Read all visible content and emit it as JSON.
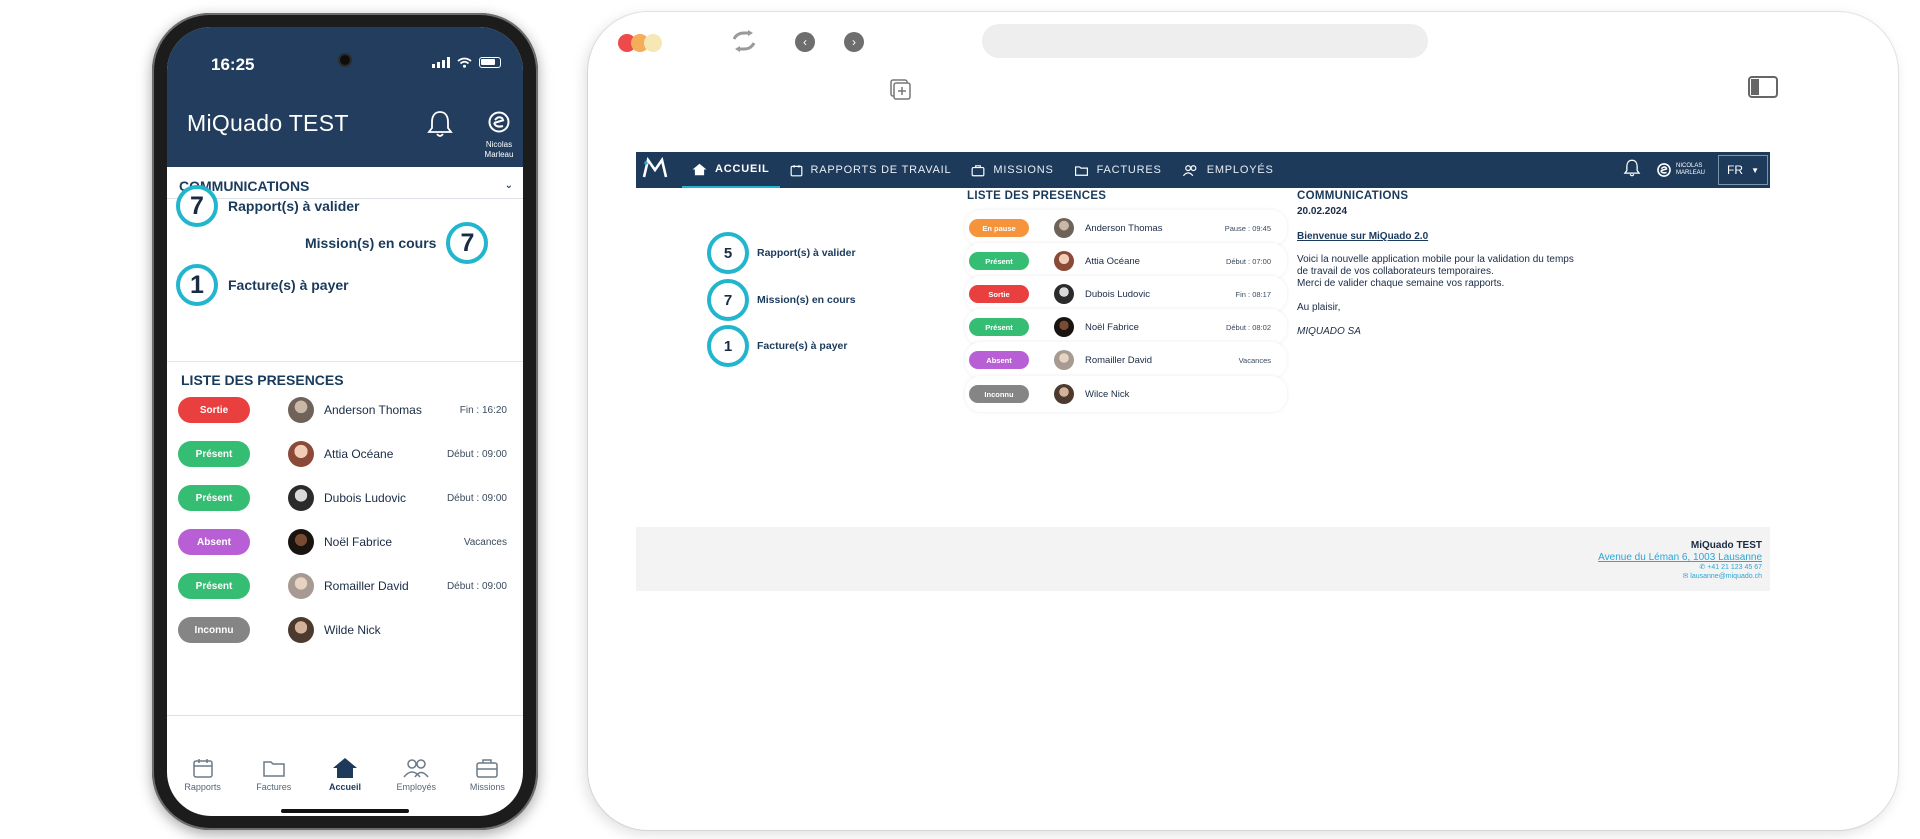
{
  "colors": {
    "navy": "#223d5d",
    "accent": "#22b5ce",
    "status_pause": "#f5943a",
    "status_present": "#35bd73",
    "status_out": "#ea3f3f",
    "status_absent": "#b85fd6",
    "status_unknown": "#858585"
  },
  "phone": {
    "time": "16:25",
    "app_title": "MiQuado TEST",
    "user_name": "Nicolas Marleau",
    "communications_title": "COMMUNICATIONS",
    "counters": [
      {
        "value": "7",
        "label": "Rapport(s) à valider"
      },
      {
        "value": "7",
        "label": "Mission(s) en cours"
      },
      {
        "value": "1",
        "label": "Facture(s) à payer"
      }
    ],
    "presences_title": "LISTE DES PRESENCES",
    "presences": [
      {
        "status": "Sortie",
        "name": "Anderson Thomas",
        "info": "Fin : 16:20"
      },
      {
        "status": "Présent",
        "name": "Attia Océane",
        "info": "Début : 09:00"
      },
      {
        "status": "Présent",
        "name": "Dubois Ludovic",
        "info": "Début : 09:00"
      },
      {
        "status": "Absent",
        "name": "Noël Fabrice",
        "info": "Vacances"
      },
      {
        "status": "Présent",
        "name": "Romailler David",
        "info": "Début : 09:00"
      },
      {
        "status": "Inconnu",
        "name": "Wilde Nick",
        "info": ""
      }
    ],
    "bottom_nav": [
      {
        "label": "Rapports",
        "icon": "calendar-icon"
      },
      {
        "label": "Factures",
        "icon": "folder-icon"
      },
      {
        "label": "Accueil",
        "icon": "home-icon"
      },
      {
        "label": "Employés",
        "icon": "users-icon"
      },
      {
        "label": "Missions",
        "icon": "briefcase-icon"
      }
    ]
  },
  "web": {
    "nav": [
      {
        "label": "ACCUEIL",
        "icon": "home-icon"
      },
      {
        "label": "RAPPORTS DE TRAVAIL",
        "icon": "calendar-icon"
      },
      {
        "label": "MISSIONS",
        "icon": "briefcase-icon"
      },
      {
        "label": "FACTURES",
        "icon": "folder-icon"
      },
      {
        "label": "EMPLOYÉS",
        "icon": "users-icon"
      }
    ],
    "user_name": "NICOLAS MARLEAU",
    "language": "FR",
    "counters": [
      {
        "value": "5",
        "label": "Rapport(s) à valider"
      },
      {
        "value": "7",
        "label": "Mission(s) en cours"
      },
      {
        "value": "1",
        "label": "Facture(s) à payer"
      }
    ],
    "presences_title": "LISTE DES PRESENCES",
    "presences": [
      {
        "status": "En pause",
        "name": "Anderson Thomas",
        "info": "Pause : 09:45"
      },
      {
        "status": "Présent",
        "name": "Attia Océane",
        "info": "Début : 07:00"
      },
      {
        "status": "Sortie",
        "name": "Dubois Ludovic",
        "info": "Fin : 08:17"
      },
      {
        "status": "Présent",
        "name": "Noël Fabrice",
        "info": "Début : 08:02"
      },
      {
        "status": "Absent",
        "name": "Romailler David",
        "info": "Vacances"
      },
      {
        "status": "Inconnu",
        "name": "Wilce Nick",
        "info": ""
      }
    ],
    "communications": {
      "title": "COMMUNICATIONS",
      "date": "20.02.2024",
      "headline": "Bienvenue sur MiQuado 2.0",
      "body_line1": "Voici la nouvelle application mobile pour la validation du temps",
      "body_line2": "de travail de vos collaborateurs temporaires.",
      "body_line3": "Merci de valider chaque semaine vos rapports.",
      "closing": "Au plaisir,",
      "signature": "MIQUADO SA"
    },
    "footer": {
      "company": "MiQuado TEST",
      "address": "Avenue du Léman 6, 1003 Lausanne",
      "phone": "+41 21 123 45 67",
      "email": "lausanne@miquado.ch"
    }
  }
}
